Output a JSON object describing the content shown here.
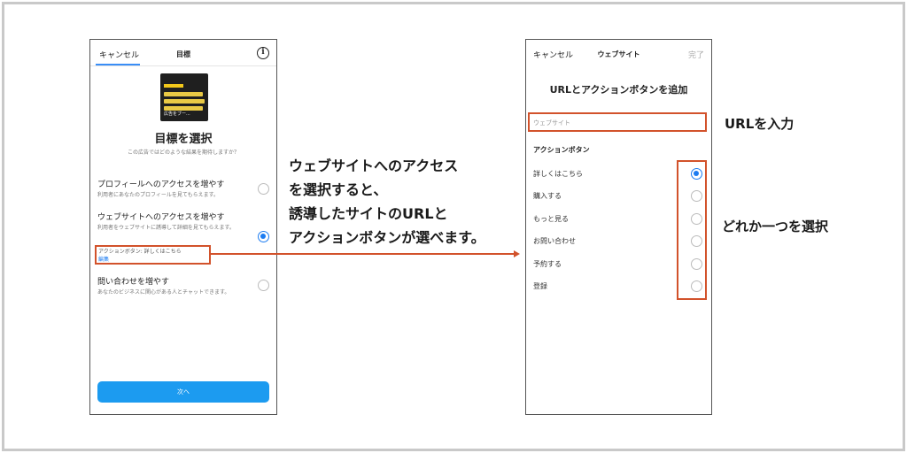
{
  "left_phone": {
    "tab_cancel": "キャンセル",
    "tab_goal": "目標",
    "info_icon": "i",
    "thumbnail": {
      "tag": "Instagram",
      "lines": [
        "写真をそのまま",
        "使ってはいけない",
        "おすすめ写真加工"
      ],
      "footer": "広告をブー..."
    },
    "title": "目標を選択",
    "subtitle": "この広告ではどのような結果を期待しますか？",
    "options": [
      {
        "title": "プロフィールへのアクセスを増やす",
        "desc": "利用者にあなたのプロフィールを見てもらえます。",
        "selected": false
      },
      {
        "title": "ウェブサイトへのアクセスを増やす",
        "desc": "利用者をウェブサイトに誘導して詳細を見てもらえます。",
        "selected": true
      },
      {
        "title": "問い合わせを増やす",
        "desc": "あなたのビジネスに関心がある人とチャットできます。",
        "selected": false
      }
    ],
    "cta_text": "アクションボタン: 詳しくはこちら",
    "cta_edit": "編集",
    "next_button": "次へ"
  },
  "right_phone": {
    "cancel": "キャンセル",
    "header_title": "ウェブサイト",
    "done": "完了",
    "title": "URLとアクションボタンを追加",
    "url_placeholder": "ウェブサイト",
    "section_label": "アクションボタン",
    "buttons": [
      {
        "label": "詳しくはこちら",
        "selected": true
      },
      {
        "label": "購入する",
        "selected": false
      },
      {
        "label": "もっと見る",
        "selected": false
      },
      {
        "label": "お問い合わせ",
        "selected": false
      },
      {
        "label": "予約する",
        "selected": false
      },
      {
        "label": "登録",
        "selected": false
      }
    ]
  },
  "annotations": {
    "middle": [
      "ウェブサイトへのアクセス",
      "を選択すると、",
      "誘導したサイトのURLと",
      "アクションボタンが選べます。"
    ],
    "url_note": "URLを入力",
    "choice_note": "どれか一つを選択"
  },
  "colors": {
    "accent": "#1c7cf1",
    "highlight": "#d2522b",
    "button": "#1c9bf0"
  }
}
